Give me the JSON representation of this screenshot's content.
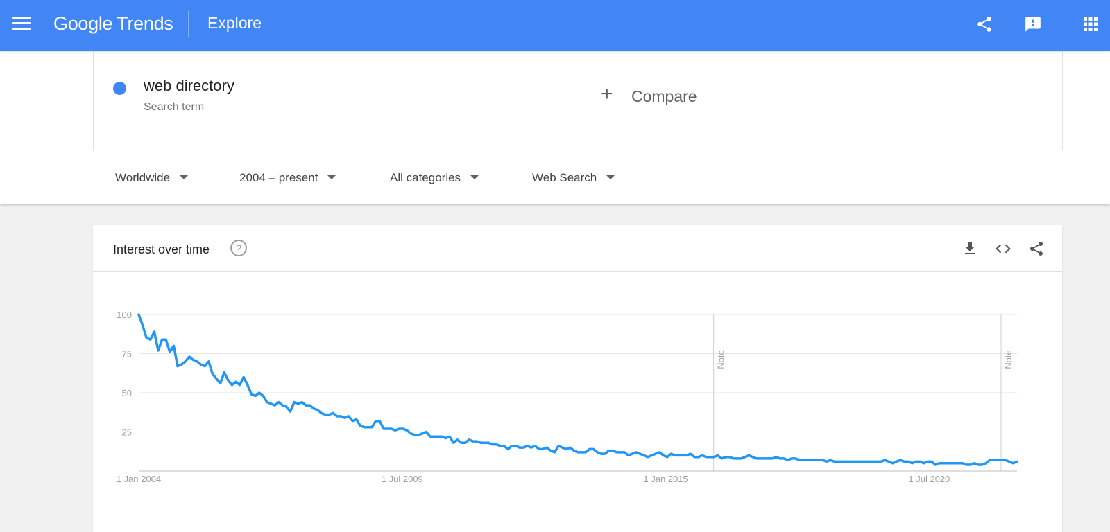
{
  "header": {
    "logo_google": "Google",
    "logo_trends": "Trends",
    "title": "Explore",
    "bg_color": "#4285f4"
  },
  "search_term": {
    "name": "web directory",
    "subtitle": "Search term",
    "color": "#4285f4"
  },
  "compare": {
    "plus": "+",
    "label": "Compare"
  },
  "filters": {
    "location": "Worldwide",
    "time": "2004 – present",
    "category": "All categories",
    "property": "Web Search"
  },
  "card": {
    "title": "Interest over time"
  },
  "icons": {
    "menu": "menu-icon",
    "share": "share-icon",
    "feedback": "feedback-icon",
    "apps": "apps-grid-icon",
    "help": "help-icon",
    "download": "download-icon",
    "embed": "embed-icon"
  },
  "chart_data": {
    "type": "line",
    "title": "",
    "xlabel": "",
    "ylabel": "",
    "ylim": [
      0,
      100
    ],
    "y_ticks": [
      25,
      50,
      75,
      100
    ],
    "x_tick_labels": [
      "1 Jan 2004",
      "1 Jul 2009",
      "1 Jan 2015",
      "1 Jul 2020"
    ],
    "x_range": [
      "2004-01",
      "2022-05"
    ],
    "notes": [
      {
        "date": "2016-01",
        "label": "Note"
      },
      {
        "date": "2022-01",
        "label": "Note"
      }
    ],
    "grid": true,
    "series": [
      {
        "color": "#2196f3",
        "values": [
          100,
          93,
          85,
          84,
          89,
          77,
          84,
          84,
          76,
          80,
          67,
          68,
          70,
          73,
          71,
          70,
          68,
          67,
          70,
          62,
          59,
          56,
          63,
          58,
          55,
          57,
          55,
          60,
          55,
          49,
          48,
          50,
          48,
          44,
          43,
          42,
          44,
          42,
          41,
          38,
          44,
          43,
          44,
          42,
          42,
          40,
          39,
          37,
          36,
          36,
          37,
          35,
          35,
          34,
          35,
          32,
          33,
          29,
          28,
          28,
          28,
          32,
          32,
          27,
          27,
          27,
          26,
          27,
          27,
          26,
          24,
          23,
          23,
          24,
          25,
          22,
          22,
          22,
          22,
          21,
          22,
          18,
          20,
          18,
          18,
          20,
          19,
          19,
          18,
          18,
          18,
          17,
          17,
          16,
          16,
          14,
          16,
          16,
          15,
          15,
          16,
          15,
          16,
          14,
          14,
          15,
          13,
          12,
          16,
          15,
          14,
          15,
          13,
          12,
          12,
          12,
          14,
          14,
          12,
          11,
          11,
          13,
          13,
          12,
          12,
          12,
          10,
          11,
          12,
          11,
          10,
          9,
          10,
          11,
          12,
          10,
          9,
          11,
          10,
          10,
          10,
          10,
          11,
          9,
          9,
          10,
          9,
          9,
          9,
          10,
          8,
          9,
          9,
          8,
          8,
          8,
          9,
          10,
          9,
          8,
          8,
          8,
          8,
          8,
          9,
          8,
          8,
          7,
          8,
          8,
          7,
          7,
          7,
          7,
          7,
          7,
          7,
          6,
          7,
          6,
          6,
          6,
          6,
          6,
          6,
          6,
          6,
          6,
          6,
          6,
          6,
          6,
          7,
          6,
          5,
          6,
          7,
          6,
          6,
          5,
          6,
          6,
          5,
          6,
          6,
          4,
          5,
          5,
          5,
          5,
          5,
          5,
          5,
          4,
          4,
          5,
          4,
          4,
          5,
          7,
          7,
          7,
          7,
          7,
          6,
          5,
          6
        ]
      }
    ]
  }
}
